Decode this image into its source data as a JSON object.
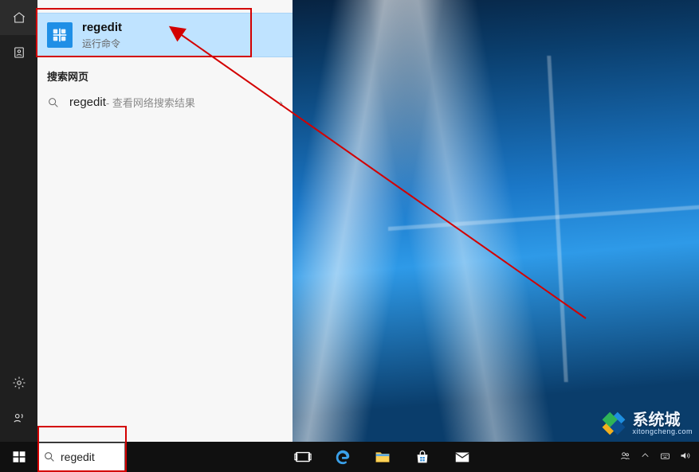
{
  "truncated_section_label": "",
  "best_match": {
    "title": "regedit",
    "subtitle": "运行命令"
  },
  "web": {
    "heading": "搜索网页",
    "term": "regedit",
    "hint": " - 查看网络搜索结果"
  },
  "search": {
    "value": "regedit",
    "placeholder": ""
  },
  "watermark": {
    "brand": "系统城",
    "sub": "xitongcheng.com"
  },
  "icons": {
    "home": "home-icon",
    "portrait": "portrait-icon",
    "gear": "gear-icon",
    "apps": "apps-icon",
    "search": "search-icon",
    "chevron_right": "›",
    "regedit": "regedit-icon",
    "start": "start-icon",
    "taskview": "task-view-icon",
    "edge": "edge-icon",
    "explorer": "file-explorer-icon",
    "store": "store-icon",
    "mail": "mail-icon",
    "people": "people-icon",
    "keyboard_up": "ime-icon",
    "battery": "battery-icon",
    "volume": "volume-icon"
  },
  "colors": {
    "highlight": "#bfe3ff",
    "annotation": "#d30000"
  }
}
